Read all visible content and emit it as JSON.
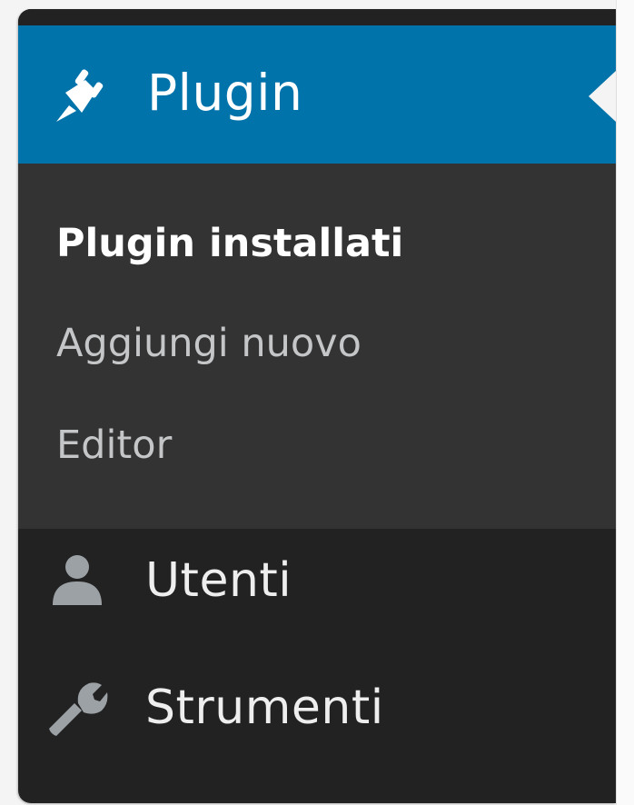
{
  "menu": {
    "plugin": {
      "label": "Plugin",
      "icon": "plug-icon",
      "submenu": [
        {
          "label": "Plugin installati",
          "current": true
        },
        {
          "label": "Aggiungi nuovo",
          "current": false
        },
        {
          "label": "Editor",
          "current": false
        }
      ]
    },
    "items": [
      {
        "label": "Utenti",
        "icon": "user-icon"
      },
      {
        "label": "Strumenti",
        "icon": "wrench-icon"
      }
    ]
  },
  "colors": {
    "active_header": "#0073aa",
    "menu_background": "#222222",
    "submenu_background": "#333333",
    "current_text": "#ffffff",
    "inactive_text": "#c4c6c8"
  }
}
